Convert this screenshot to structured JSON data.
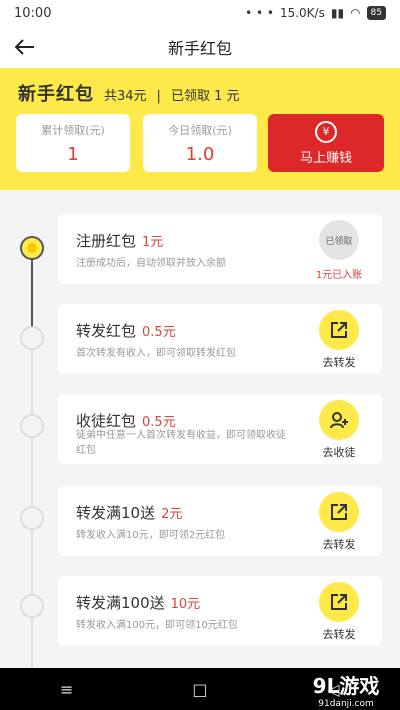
{
  "status_bar": {
    "time": "10:00",
    "speed": "15.0K/s",
    "battery": "85"
  },
  "nav": {
    "title": "新手红包"
  },
  "header": {
    "title": "新手红包",
    "total": "共34元",
    "claimed": "已领取 1 元",
    "cumulative_label": "累计领取(元)",
    "cumulative_value": "1",
    "today_label": "今日领取(元)",
    "today_value": "1.0",
    "earn_button": "马上赚钱"
  },
  "tasks": [
    {
      "title": "注册红包",
      "amount": "1元",
      "desc": "注册成功后，自动领取并放入余额",
      "status": "已领取",
      "status_sub": "1元已入账"
    },
    {
      "title": "转发红包",
      "amount": "0.5元",
      "desc": "首次转发有收入，即可领取转发红包",
      "action": "去转发"
    },
    {
      "title": "收徒红包",
      "amount": "0.5元",
      "desc": "徒弟中任意一人首次转发有收益，即可领取收徒红包",
      "action": "去收徒"
    },
    {
      "title": "转发满10送",
      "amount": "2元",
      "desc": "转发收入满10元，即可领2元红包",
      "action": "去转发"
    },
    {
      "title": "转发满100送",
      "amount": "10元",
      "desc": "转发收入满100元，即可领10元红包",
      "action": "去转发"
    }
  ],
  "watermark": {
    "text": "9L游戏",
    "sub": "91danji.com"
  },
  "colors": {
    "accent_yellow": "#fde94a",
    "accent_red": "#dc2828",
    "amount_red": "#d6453d"
  }
}
